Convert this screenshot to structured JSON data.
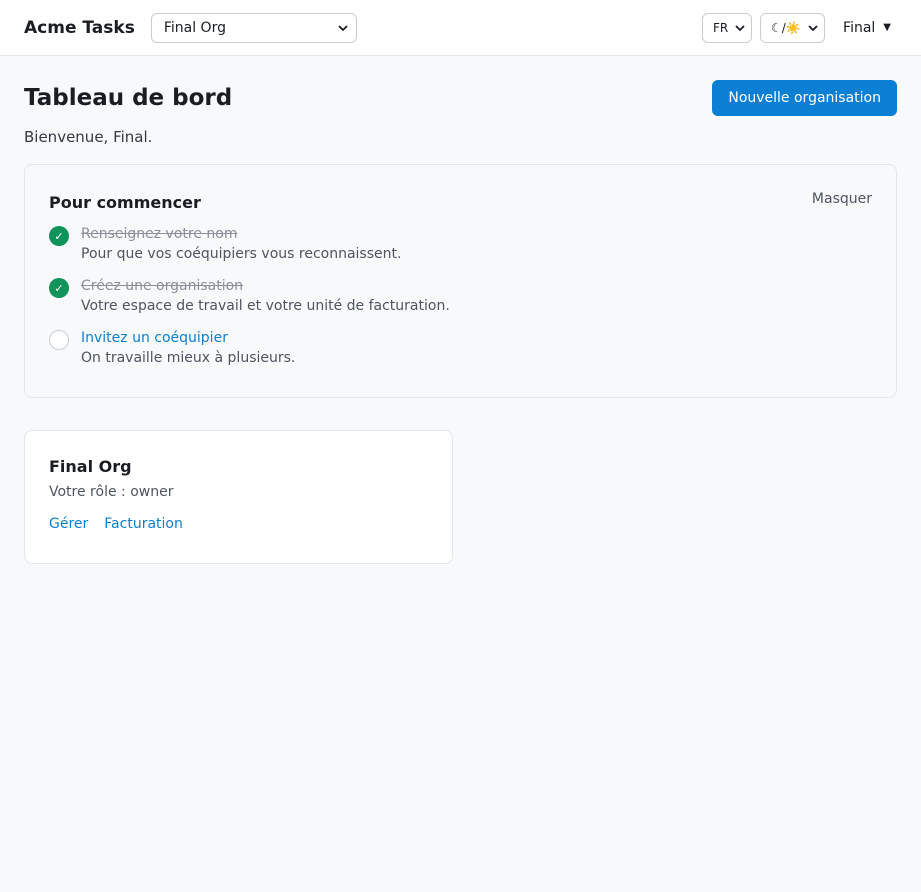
{
  "header": {
    "brand": "Acme Tasks",
    "org_select_value": "Final Org",
    "lang_select_value": "FR",
    "theme_select_value": "☾/☀️",
    "user_name": "Final",
    "user_caret": "▼"
  },
  "page": {
    "title": "Tableau de bord",
    "new_org_button": "Nouvelle organisation",
    "welcome": "Bienvenue, Final."
  },
  "checklist": {
    "title": "Pour commencer",
    "hide_label": "Masquer",
    "steps": [
      {
        "title": "Renseignez votre nom",
        "desc": "Pour que vos coéquipiers vous reconnaissent.",
        "done": true,
        "check": "✓"
      },
      {
        "title": "Créez une organisation",
        "desc": "Votre espace de travail et votre unité de facturation.",
        "done": true,
        "check": "✓"
      },
      {
        "title": "Invitez un coéquipier",
        "desc": "On travaille mieux à plusieurs.",
        "done": false,
        "check": ""
      }
    ]
  },
  "org_card": {
    "name": "Final Org",
    "role": "Votre rôle : owner",
    "manage_link": "Gérer",
    "billing_link": "Facturation"
  },
  "colors": {
    "accent": "#0a7fd4",
    "success": "#11935c",
    "background": "#f8f9fb"
  }
}
